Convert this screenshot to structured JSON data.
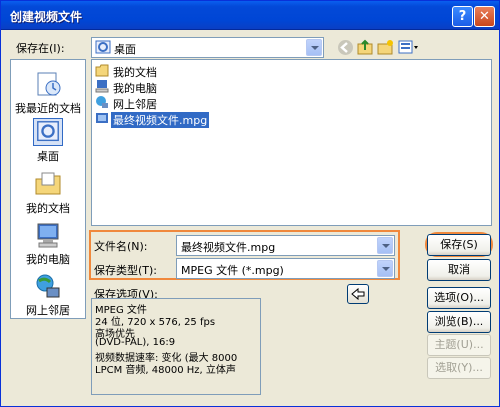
{
  "window": {
    "title": "创建视频文件",
    "help_label": "?",
    "close_label": "✕"
  },
  "location": {
    "label": "保存在(I):",
    "value": "桌面"
  },
  "places": [
    {
      "label": "我最近的文档",
      "icon": "recent-docs-icon"
    },
    {
      "label": "桌面",
      "icon": "desktop-icon"
    },
    {
      "label": "我的文档",
      "icon": "my-documents-icon"
    },
    {
      "label": "我的电脑",
      "icon": "my-computer-icon"
    },
    {
      "label": "网上邻居",
      "icon": "network-places-icon"
    }
  ],
  "files": [
    {
      "name": "我的文档",
      "icon": "folder-icon"
    },
    {
      "name": "我的电脑",
      "icon": "computer-icon"
    },
    {
      "name": "网上邻居",
      "icon": "network-icon"
    },
    {
      "name": "最终视频文件.mpg",
      "icon": "mpg-file-icon",
      "selected": true
    }
  ],
  "filename": {
    "label": "文件名(N):",
    "value": "最终视频文件.mpg"
  },
  "filetype": {
    "label": "保存类型(T):",
    "value": "MPEG 文件 (*.mpg)"
  },
  "buttons": {
    "save": "保存(S)",
    "cancel": "取消",
    "options": "选项(O)...",
    "browse": "浏览(B)...",
    "theme": "主题(U)...",
    "select": "选取(Y)..."
  },
  "save_options": {
    "label": "保存选项(V):",
    "lines": [
      "MPEG 文件",
      "24 位, 720 x 576, 25 fps",
      "高场优先",
      "(DVD-PAL), 16:9",
      "视频数据速率: 变化 (最大 8000",
      "LPCM 音频, 48000 Hz, 立体声"
    ]
  },
  "colors": {
    "title_bar": "#0046d5",
    "highlight": "#f0883c",
    "selection": "#316ac5"
  }
}
